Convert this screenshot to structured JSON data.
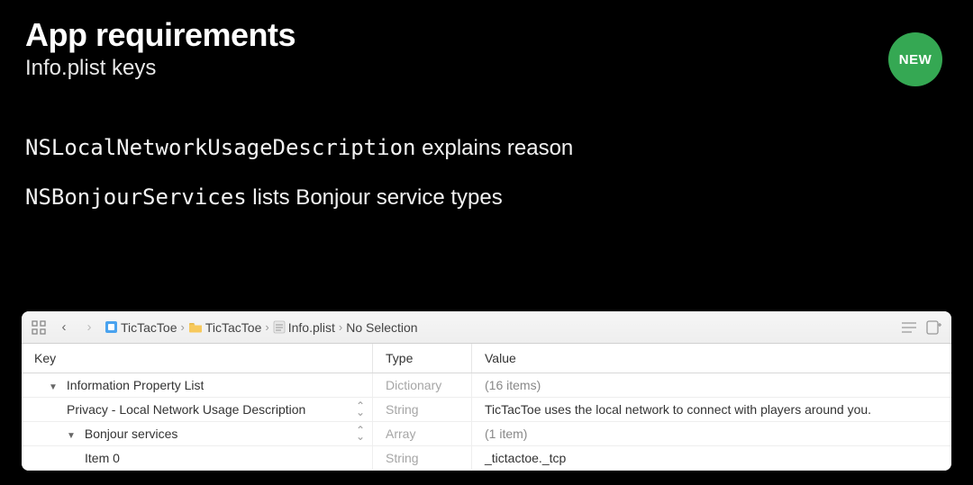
{
  "header": {
    "title": "App requirements",
    "subtitle": "Info.plist keys"
  },
  "badge": "NEW",
  "bullets": {
    "line1_code": "NSLocalNetworkUsageDescription",
    "line1_text": " explains reason",
    "line2_code": "NSBonjourServices",
    "line2_text": " lists Bonjour service types"
  },
  "breadcrumb": {
    "item1": "TicTacToe",
    "item2": "TicTacToe",
    "item3": "Info.plist",
    "item4": "No Selection"
  },
  "table": {
    "headers": {
      "key": "Key",
      "type": "Type",
      "value": "Value"
    },
    "rows": [
      {
        "key": "Information Property List",
        "type": "Dictionary",
        "value": "(16 items)",
        "indent": 1,
        "stepper": false,
        "disclosure": true,
        "muted": true
      },
      {
        "key": "Privacy - Local Network Usage Description",
        "type": "String",
        "value": "TicTacToe uses the local network to connect with players around you.",
        "indent": 2,
        "stepper": true,
        "disclosure": false,
        "muted": false
      },
      {
        "key": "Bonjour services",
        "type": "Array",
        "value": "(1 item)",
        "indent": 2,
        "stepper": true,
        "disclosure": true,
        "muted": true
      },
      {
        "key": "Item 0",
        "type": "String",
        "value": "_tictactoe._tcp",
        "indent": 3,
        "stepper": false,
        "disclosure": false,
        "muted": false
      }
    ]
  }
}
